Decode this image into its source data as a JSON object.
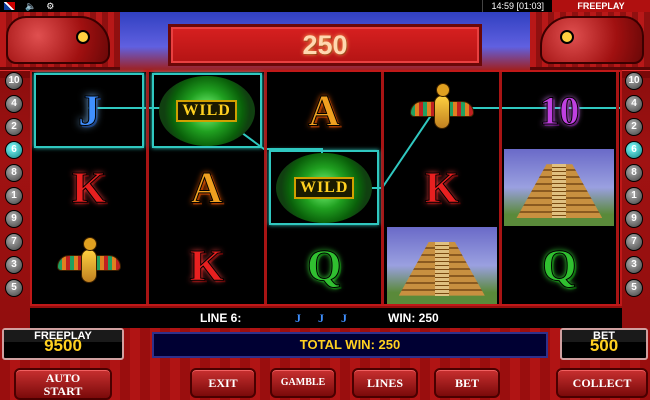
{
  "status_bar": {
    "flag": "uk-flag-icon",
    "clock": "14:59 [01:03]",
    "mode": "FREEPLAY"
  },
  "header": {
    "win_amount": "250"
  },
  "reels": [
    [
      "J",
      "K",
      "bird"
    ],
    [
      "WILD",
      "A",
      "K"
    ],
    [
      "A",
      "WILD",
      "Q"
    ],
    [
      "bird",
      "K",
      "pyramid"
    ],
    [
      "10",
      "pyramid",
      "Q"
    ]
  ],
  "symbols": {
    "wild_label": "WILD",
    "letter_A": "A",
    "letter_K": "K",
    "letter_Q": "Q",
    "letter_J": "J",
    "letter_10": "10"
  },
  "line_markers": {
    "left": [
      "10",
      "4",
      "2",
      "6",
      "8",
      "1",
      "9",
      "7",
      "3",
      "5"
    ],
    "right": [
      "10",
      "4",
      "2",
      "6",
      "8",
      "1",
      "9",
      "7",
      "3",
      "5"
    ],
    "active": "6"
  },
  "info_bar": {
    "line_label": "LINE 6:",
    "mini_symbols": [
      "J",
      "J",
      "J"
    ],
    "win_label": "WIN: 250"
  },
  "freeplay_box": {
    "caption": "FREEPLAY",
    "value": "9500"
  },
  "bet_box": {
    "caption": "BET",
    "value": "500"
  },
  "total_win": "TOTAL WIN: 250",
  "buttons": {
    "auto_start": [
      "AUTO",
      "START"
    ],
    "exit": "EXIT",
    "gamble": "GAMBLE",
    "lines": "LINES",
    "bet": "BET",
    "collect": "COLLECT"
  },
  "colors": {
    "frame_red": "#b01414",
    "highlight_cyan": "#30c8c0",
    "value_yellow": "#ffd020"
  }
}
